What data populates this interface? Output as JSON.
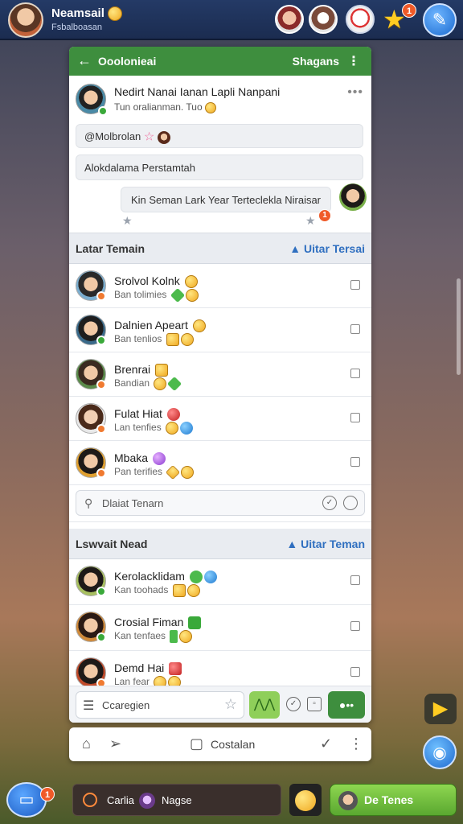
{
  "topbar": {
    "username": "Neamsail",
    "subtitle": "Fsbalboasan",
    "star_badge": "1"
  },
  "panel": {
    "header_title": "Ooolonieai",
    "header_right": "Shagans"
  },
  "message": {
    "name": "Nedirt Nanai Ianan Lapli Nanpani",
    "subtitle": "Tun oralianman. Tuo",
    "bubble1": "@Molbrolan",
    "bubble2": "Alokdalama Perstamtah",
    "bubble3": "Kin Seman Lark Year Terteclekla Niraisar",
    "reply_badge": "1"
  },
  "friends_section": {
    "title": "Latar Temain",
    "action": "Uitar Tersai",
    "items": [
      {
        "name": "Srolvol Kolnk",
        "sub": "Ban tolimies"
      },
      {
        "name": "Dalnien Apeart",
        "sub": "Ban tenlios"
      },
      {
        "name": "Brenrai",
        "sub": "Bandian"
      },
      {
        "name": "Fulat Hiat",
        "sub": "Lan tenfies"
      },
      {
        "name": "Mbaka",
        "sub": "Pan terifies"
      }
    ],
    "search_placeholder": "Dlaiat Tenarn"
  },
  "nearby_section": {
    "title": "Lswvait Nead",
    "action": "Uitar Teman",
    "items": [
      {
        "name": "Kerolacklidam",
        "sub": "Kan toohads"
      },
      {
        "name": "Crosial Fiman",
        "sub": "Kan tenfaes"
      },
      {
        "name": "Demd Hai",
        "sub": "Lan fear"
      }
    ]
  },
  "composer": {
    "placeholder": "Ccaregien"
  },
  "bottom_nav": {
    "label": "Costalan"
  },
  "dock": {
    "left_badge": "1",
    "tab_a": "Carlia",
    "tab_b": "Nagse",
    "right_label": "De Tenes"
  },
  "colors": {
    "accent_green": "#3e8e3e",
    "link_blue": "#2f6fc0",
    "badge_orange": "#f05a28"
  }
}
